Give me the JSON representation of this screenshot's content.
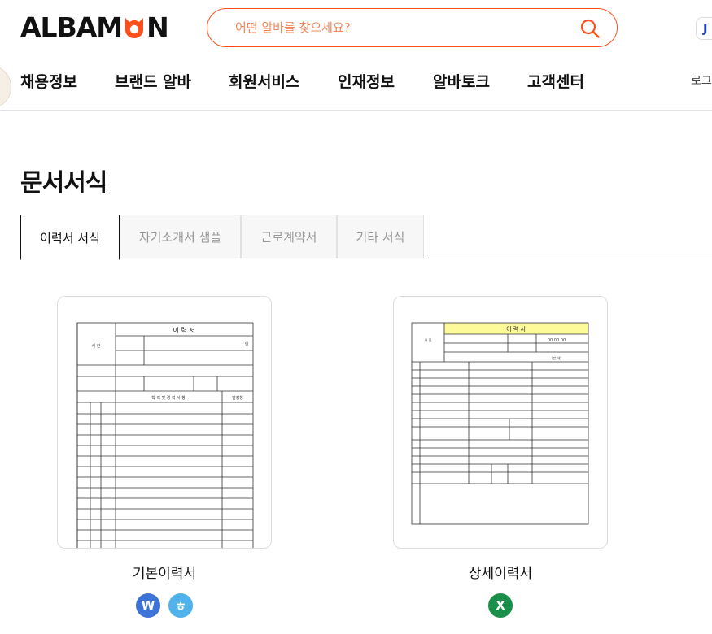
{
  "brand": {
    "logo_text_a": "ALBAM",
    "logo_text_b": "N",
    "accent": "#ff501b"
  },
  "search": {
    "placeholder": "어떤 알바를 찾으세요?"
  },
  "corner_badge": "J",
  "nav": {
    "items": [
      "채용정보",
      "브랜드 알바",
      "회원서비스",
      "인재정보",
      "알바토크",
      "고객센터"
    ],
    "login": "로그"
  },
  "page_title": "문서서식",
  "tabs": [
    {
      "label": "이력서 서식",
      "active": true
    },
    {
      "label": "자기소개서 샘플",
      "active": false
    },
    {
      "label": "근로계약서",
      "active": false
    },
    {
      "label": "기타 서식",
      "active": false
    }
  ],
  "cards": [
    {
      "title": "기본이력서",
      "thumb": {
        "title": "이 력 서",
        "header": "학 력 및 경 력 사 항",
        "col_right": "발령청",
        "photo": "사 진",
        "seal": "인"
      },
      "downloads": [
        {
          "icon": "word-icon",
          "glyph": "W",
          "color": "#3d72d6"
        },
        {
          "icon": "hwp-icon",
          "glyph": "ㅎ",
          "color": "#4fb2ea"
        }
      ]
    },
    {
      "title": "상세이력서",
      "thumb": {
        "title": "이 력 서",
        "date": "00.00.00",
        "note": "(만   세)",
        "photo": "사 진"
      },
      "downloads": [
        {
          "icon": "excel-icon",
          "glyph": "X",
          "color": "#1a8f4a"
        }
      ]
    }
  ]
}
